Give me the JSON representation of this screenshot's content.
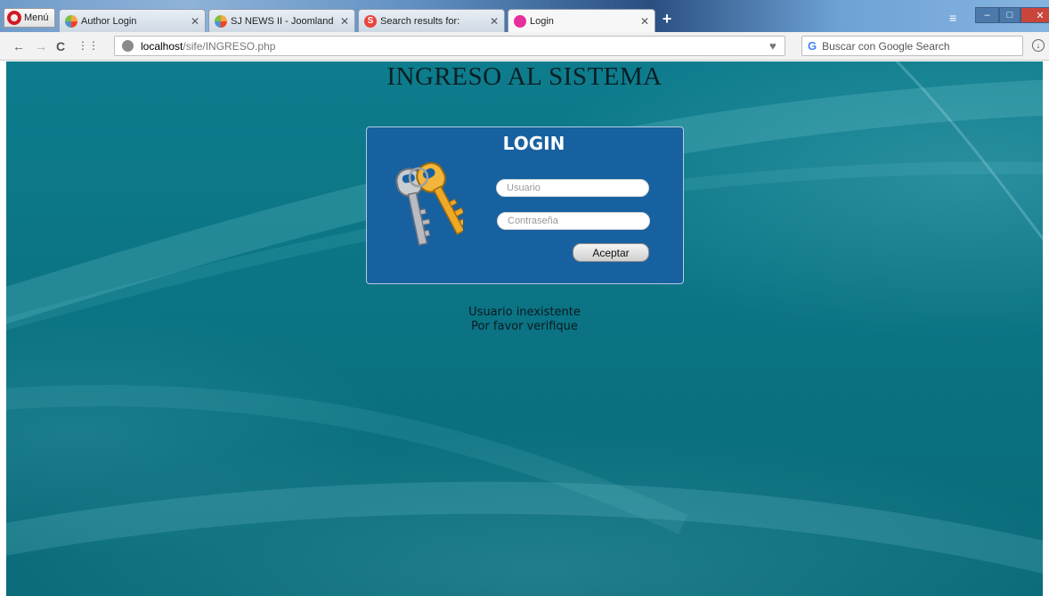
{
  "browser": {
    "menu_label": "Menú",
    "tabs": [
      {
        "label": "Author Login",
        "icon": "joomla-icon"
      },
      {
        "label": "SJ NEWS II - Joomland",
        "icon": "joomla-icon"
      },
      {
        "label": "Search results for:",
        "icon": "s-icon"
      },
      {
        "label": "Login",
        "icon": "login-icon",
        "active": true
      }
    ],
    "url_host": "localhost",
    "url_path": "/sife/INGRESO.php",
    "search_placeholder": "Buscar con Google Search"
  },
  "page": {
    "heading": "INGRESO AL SISTEMA",
    "login": {
      "title": "LOGIN",
      "user_placeholder": "Usuario",
      "password_placeholder": "Contraseña",
      "submit_label": "Aceptar"
    },
    "message_line1": "Usuario inexistente",
    "message_line2": "Por favor verifique"
  },
  "colors": {
    "background": "#0b7282",
    "login_box": "#1761a0",
    "accent_opera": "#d11a25"
  }
}
